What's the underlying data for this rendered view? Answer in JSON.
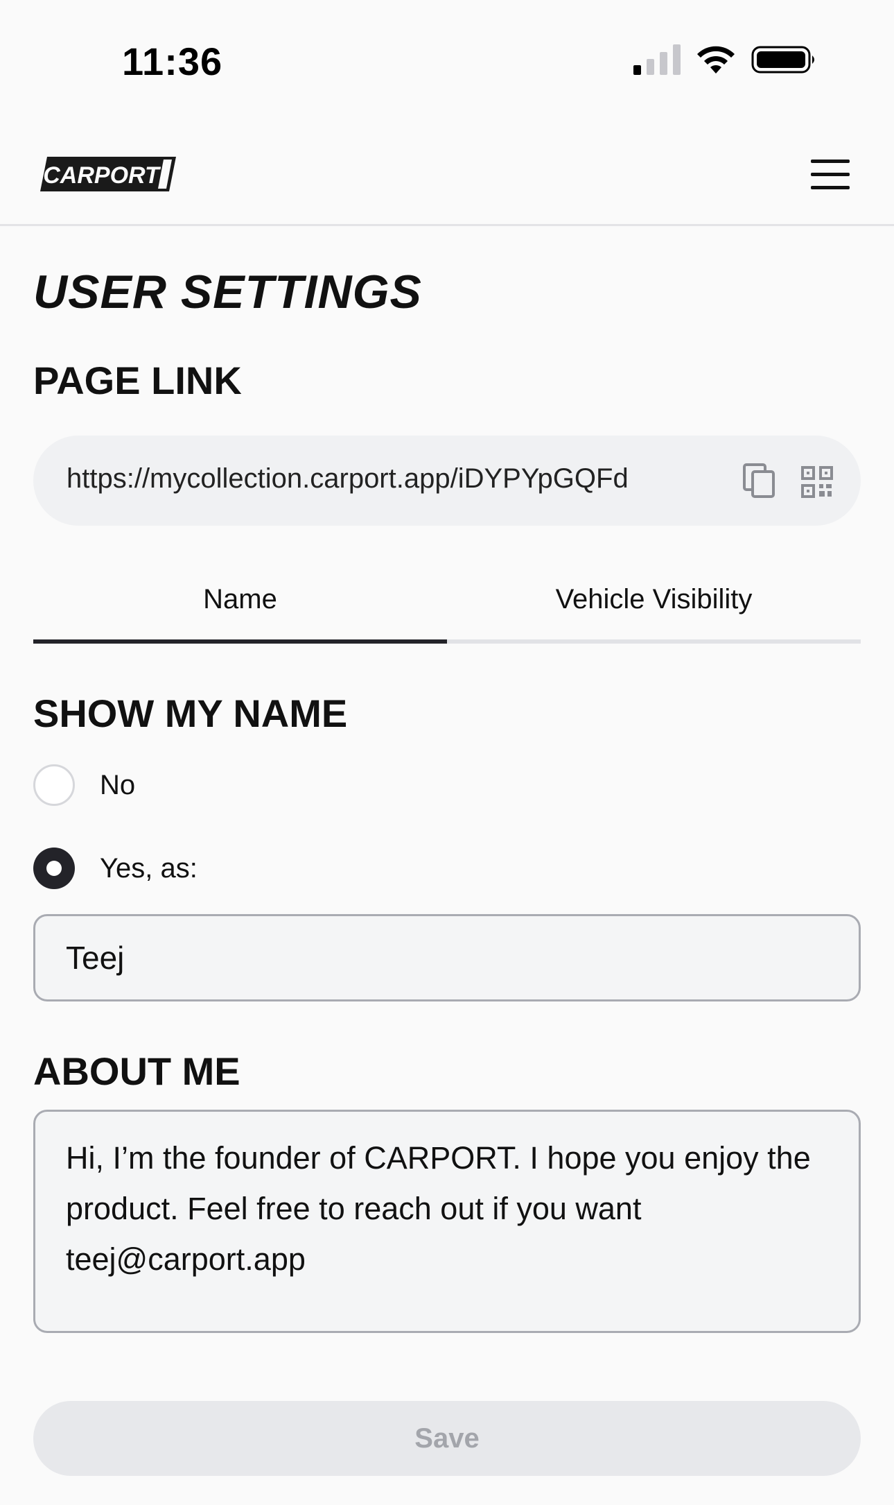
{
  "status_bar": {
    "time": "11:36"
  },
  "header": {
    "logo_text": "CARPORT",
    "menu_icon": "hamburger-menu-icon"
  },
  "page": {
    "title": "USER SETTINGS"
  },
  "page_link": {
    "heading": "PAGE LINK",
    "url": "https://mycollection.carport.app/iDYPYpGQFd",
    "copy_icon": "copy-icon",
    "qr_icon": "qr-code-icon"
  },
  "tabs": [
    {
      "label": "Name",
      "active": true
    },
    {
      "label": "Vehicle Visibility",
      "active": false
    }
  ],
  "show_name": {
    "heading": "SHOW MY NAME",
    "options": [
      {
        "label": "No",
        "selected": false
      },
      {
        "label": "Yes, as:",
        "selected": true
      }
    ],
    "name_value": "Teej"
  },
  "about": {
    "heading": "ABOUT ME",
    "text": "Hi, I’m the founder of CARPORT. I hope you enjoy the product. Feel free to reach out if you want teej@carport.app"
  },
  "actions": {
    "save_label": "Save"
  },
  "colors": {
    "accent": "#232329",
    "background": "#fafafa",
    "input_border": "#a9abb2",
    "disabled_text": "#a3a5ab"
  }
}
